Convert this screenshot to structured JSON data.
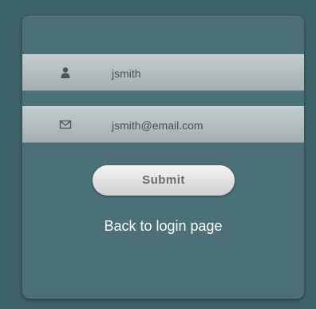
{
  "form": {
    "username_value": "jsmith",
    "username_icon": "user-icon",
    "email_value": "jsmith@email.com",
    "email_icon": "envelope-icon",
    "submit_label": "Submit",
    "back_link_label": "Back to login page"
  },
  "colors": {
    "background": "#3d6169",
    "card": "#4b7077",
    "field": "#b4bec0",
    "button": "#e4e4e4",
    "link_text": "#ffffff"
  }
}
